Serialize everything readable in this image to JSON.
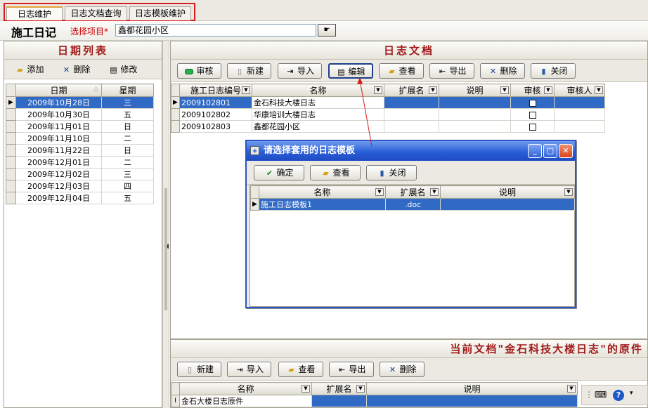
{
  "tabs": [
    {
      "label": "日志维护",
      "active": true
    },
    {
      "label": "日志文档查询",
      "active": false
    },
    {
      "label": "日志模板维护",
      "active": false
    }
  ],
  "project": {
    "title": "施工日记",
    "select_label": "选择项目*",
    "value": "鑫都花园小区"
  },
  "date_panel": {
    "title": "日期列表",
    "buttons": {
      "add": "添加",
      "delete": "删除",
      "edit": "修改"
    },
    "columns": {
      "date": "日期",
      "weekday": "星期"
    },
    "rows": [
      {
        "date": "2009年10月28日",
        "weekday": "三"
      },
      {
        "date": "2009年10月30日",
        "weekday": "五"
      },
      {
        "date": "2009年11月01日",
        "weekday": "日"
      },
      {
        "date": "2009年11月10日",
        "weekday": "二"
      },
      {
        "date": "2009年11月22日",
        "weekday": "日"
      },
      {
        "date": "2009年12月01日",
        "weekday": "二"
      },
      {
        "date": "2009年12月02日",
        "weekday": "三"
      },
      {
        "date": "2009年12月03日",
        "weekday": "四"
      },
      {
        "date": "2009年12月04日",
        "weekday": "五"
      }
    ]
  },
  "doc_panel": {
    "title": "日志文档",
    "buttons": {
      "audit": "审核",
      "new": "新建",
      "import": "导入",
      "edit": "编辑",
      "view": "查看",
      "export": "导出",
      "delete": "删除",
      "close": "关闭"
    },
    "columns": {
      "code": "施工日志编号",
      "name": "名称",
      "ext": "扩展名",
      "desc": "说明",
      "audit": "审核",
      "auditor": "审核人"
    },
    "rows": [
      {
        "code": "2009102801",
        "name": "金石科技大楼日志",
        "ext": "",
        "desc": "",
        "auditor": ""
      },
      {
        "code": "2009102802",
        "name": "华康培训大楼日志",
        "ext": "",
        "desc": "",
        "auditor": ""
      },
      {
        "code": "2009102803",
        "name": "鑫都花园小区",
        "ext": "",
        "desc": "",
        "auditor": ""
      }
    ]
  },
  "dialog": {
    "title": "请选择套用的日志模板",
    "buttons": {
      "ok": "确定",
      "view": "查看",
      "close": "关闭"
    },
    "columns": {
      "name": "名称",
      "ext": "扩展名",
      "desc": "说明"
    },
    "rows": [
      {
        "name": "施工日志模板1",
        "ext": ".doc",
        "desc": ""
      }
    ]
  },
  "original_panel": {
    "title": "当前文档\"金石科技大楼日志\"的原件",
    "buttons": {
      "new": "新建",
      "import": "导入",
      "view": "查看",
      "export": "导出",
      "delete": "删除"
    },
    "columns": {
      "name": "名称",
      "ext": "扩展名",
      "desc": "说明"
    },
    "rows": [
      {
        "name": "金石大楼日志原件",
        "ext": "",
        "desc": ""
      }
    ]
  },
  "colors": {
    "accent_red": "#d61f1f",
    "selection_blue": "#316ac5",
    "title_bar_blue": "#2a5ed8"
  }
}
